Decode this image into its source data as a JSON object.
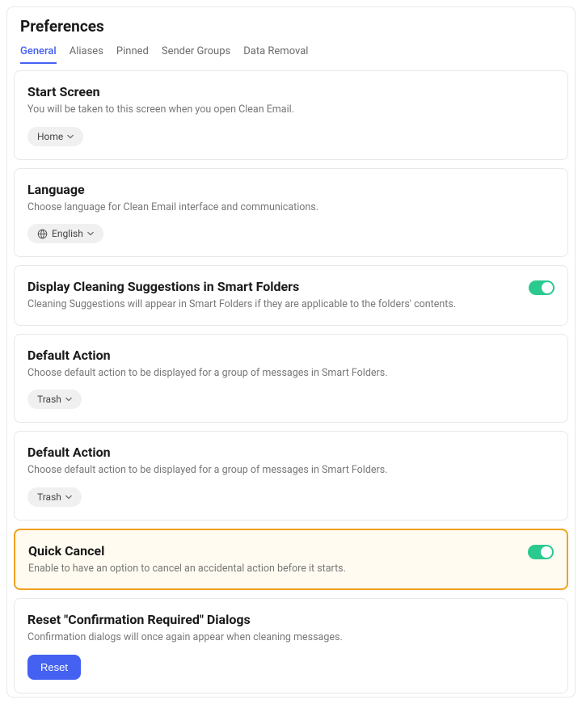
{
  "pageTitle": "Preferences",
  "tabs": {
    "general": "General",
    "aliases": "Aliases",
    "pinned": "Pinned",
    "senderGroups": "Sender Groups",
    "dataRemoval": "Data Removal"
  },
  "startScreen": {
    "title": "Start Screen",
    "desc": "You will be taken to this screen when you open Clean Email.",
    "value": "Home"
  },
  "language": {
    "title": "Language",
    "desc": "Choose language for Clean Email interface and communications.",
    "value": "English"
  },
  "cleaningSuggestions": {
    "title": "Display Cleaning Suggestions in Smart Folders",
    "desc": "Cleaning Suggestions will appear in Smart Folders if they are applicable to the folders' contents."
  },
  "defaultAction1": {
    "title": "Default Action",
    "desc": "Choose default action to be displayed for a group of messages in Smart Folders.",
    "value": "Trash"
  },
  "defaultAction2": {
    "title": "Default Action",
    "desc": "Choose default action to be displayed for a group of messages in Smart Folders.",
    "value": "Trash"
  },
  "quickCancel": {
    "title": "Quick Cancel",
    "desc": "Enable to have an option to cancel an accidental action before it starts."
  },
  "resetDialogs": {
    "title": "Reset \"Confirmation Required\" Dialogs",
    "desc": "Confirmation dialogs will once again appear when cleaning messages.",
    "button": "Reset"
  }
}
